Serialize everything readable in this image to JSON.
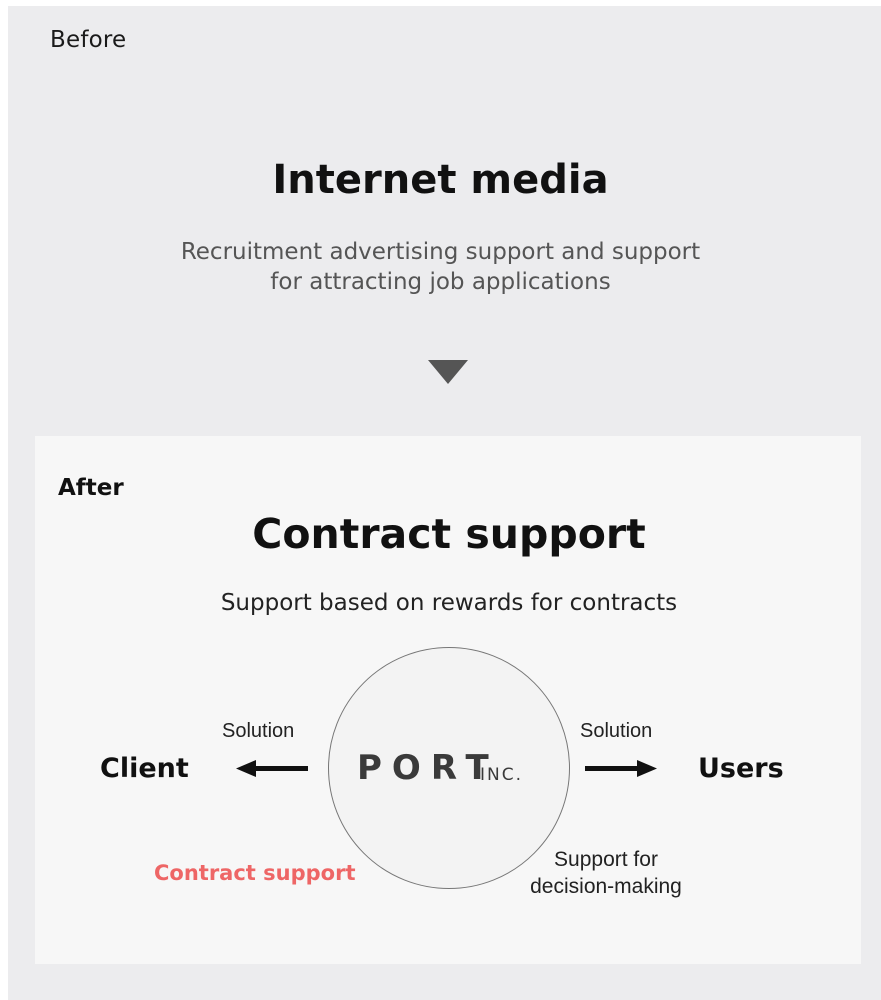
{
  "before": {
    "label": "Before",
    "title": "Internet media",
    "description_line1": "Recruitment advertising support and support",
    "description_line2": "for attracting job applications"
  },
  "after": {
    "label": "After",
    "title": "Contract support",
    "description": "Support based on rewards for contracts"
  },
  "center": {
    "logo_main": "PORT",
    "logo_sub": "INC."
  },
  "left": {
    "arrow_label": "Solution",
    "node": "Client"
  },
  "right": {
    "arrow_label": "Solution",
    "node": "Users"
  },
  "bottom_left_label": "Contract support",
  "bottom_right_label_line1": "Support for",
  "bottom_right_label_line2": "decision-making",
  "colors": {
    "outer_background": "#ececee",
    "inner_background": "#f7f7f7",
    "accent_red": "#ee6666",
    "arrow": "#111111"
  },
  "icons": {
    "down_arrow": "triangle-down-icon",
    "left_arrow": "arrow-left-icon",
    "right_arrow": "arrow-right-icon"
  }
}
